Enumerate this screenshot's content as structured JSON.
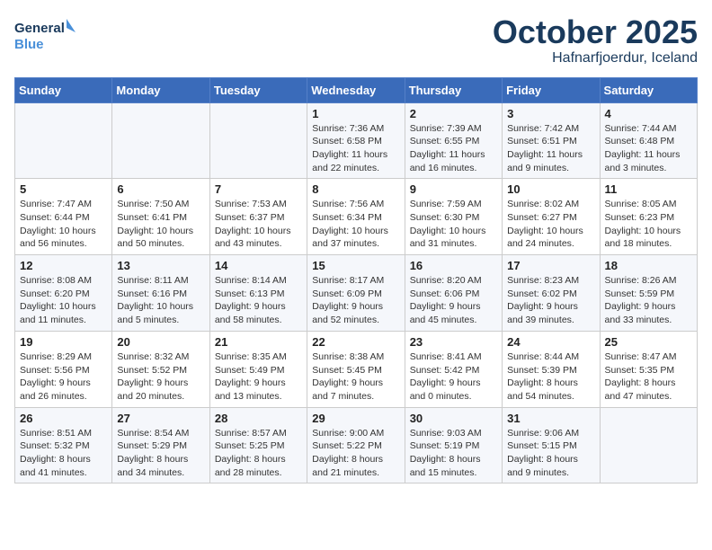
{
  "header": {
    "logo_line1": "General",
    "logo_line2": "Blue",
    "month": "October 2025",
    "location": "Hafnarfjoerdur, Iceland"
  },
  "weekdays": [
    "Sunday",
    "Monday",
    "Tuesday",
    "Wednesday",
    "Thursday",
    "Friday",
    "Saturday"
  ],
  "weeks": [
    [
      {
        "day": "",
        "info": ""
      },
      {
        "day": "",
        "info": ""
      },
      {
        "day": "",
        "info": ""
      },
      {
        "day": "1",
        "info": "Sunrise: 7:36 AM\nSunset: 6:58 PM\nDaylight: 11 hours\nand 22 minutes."
      },
      {
        "day": "2",
        "info": "Sunrise: 7:39 AM\nSunset: 6:55 PM\nDaylight: 11 hours\nand 16 minutes."
      },
      {
        "day": "3",
        "info": "Sunrise: 7:42 AM\nSunset: 6:51 PM\nDaylight: 11 hours\nand 9 minutes."
      },
      {
        "day": "4",
        "info": "Sunrise: 7:44 AM\nSunset: 6:48 PM\nDaylight: 11 hours\nand 3 minutes."
      }
    ],
    [
      {
        "day": "5",
        "info": "Sunrise: 7:47 AM\nSunset: 6:44 PM\nDaylight: 10 hours\nand 56 minutes."
      },
      {
        "day": "6",
        "info": "Sunrise: 7:50 AM\nSunset: 6:41 PM\nDaylight: 10 hours\nand 50 minutes."
      },
      {
        "day": "7",
        "info": "Sunrise: 7:53 AM\nSunset: 6:37 PM\nDaylight: 10 hours\nand 43 minutes."
      },
      {
        "day": "8",
        "info": "Sunrise: 7:56 AM\nSunset: 6:34 PM\nDaylight: 10 hours\nand 37 minutes."
      },
      {
        "day": "9",
        "info": "Sunrise: 7:59 AM\nSunset: 6:30 PM\nDaylight: 10 hours\nand 31 minutes."
      },
      {
        "day": "10",
        "info": "Sunrise: 8:02 AM\nSunset: 6:27 PM\nDaylight: 10 hours\nand 24 minutes."
      },
      {
        "day": "11",
        "info": "Sunrise: 8:05 AM\nSunset: 6:23 PM\nDaylight: 10 hours\nand 18 minutes."
      }
    ],
    [
      {
        "day": "12",
        "info": "Sunrise: 8:08 AM\nSunset: 6:20 PM\nDaylight: 10 hours\nand 11 minutes."
      },
      {
        "day": "13",
        "info": "Sunrise: 8:11 AM\nSunset: 6:16 PM\nDaylight: 10 hours\nand 5 minutes."
      },
      {
        "day": "14",
        "info": "Sunrise: 8:14 AM\nSunset: 6:13 PM\nDaylight: 9 hours\nand 58 minutes."
      },
      {
        "day": "15",
        "info": "Sunrise: 8:17 AM\nSunset: 6:09 PM\nDaylight: 9 hours\nand 52 minutes."
      },
      {
        "day": "16",
        "info": "Sunrise: 8:20 AM\nSunset: 6:06 PM\nDaylight: 9 hours\nand 45 minutes."
      },
      {
        "day": "17",
        "info": "Sunrise: 8:23 AM\nSunset: 6:02 PM\nDaylight: 9 hours\nand 39 minutes."
      },
      {
        "day": "18",
        "info": "Sunrise: 8:26 AM\nSunset: 5:59 PM\nDaylight: 9 hours\nand 33 minutes."
      }
    ],
    [
      {
        "day": "19",
        "info": "Sunrise: 8:29 AM\nSunset: 5:56 PM\nDaylight: 9 hours\nand 26 minutes."
      },
      {
        "day": "20",
        "info": "Sunrise: 8:32 AM\nSunset: 5:52 PM\nDaylight: 9 hours\nand 20 minutes."
      },
      {
        "day": "21",
        "info": "Sunrise: 8:35 AM\nSunset: 5:49 PM\nDaylight: 9 hours\nand 13 minutes."
      },
      {
        "day": "22",
        "info": "Sunrise: 8:38 AM\nSunset: 5:45 PM\nDaylight: 9 hours\nand 7 minutes."
      },
      {
        "day": "23",
        "info": "Sunrise: 8:41 AM\nSunset: 5:42 PM\nDaylight: 9 hours\nand 0 minutes."
      },
      {
        "day": "24",
        "info": "Sunrise: 8:44 AM\nSunset: 5:39 PM\nDaylight: 8 hours\nand 54 minutes."
      },
      {
        "day": "25",
        "info": "Sunrise: 8:47 AM\nSunset: 5:35 PM\nDaylight: 8 hours\nand 47 minutes."
      }
    ],
    [
      {
        "day": "26",
        "info": "Sunrise: 8:51 AM\nSunset: 5:32 PM\nDaylight: 8 hours\nand 41 minutes."
      },
      {
        "day": "27",
        "info": "Sunrise: 8:54 AM\nSunset: 5:29 PM\nDaylight: 8 hours\nand 34 minutes."
      },
      {
        "day": "28",
        "info": "Sunrise: 8:57 AM\nSunset: 5:25 PM\nDaylight: 8 hours\nand 28 minutes."
      },
      {
        "day": "29",
        "info": "Sunrise: 9:00 AM\nSunset: 5:22 PM\nDaylight: 8 hours\nand 21 minutes."
      },
      {
        "day": "30",
        "info": "Sunrise: 9:03 AM\nSunset: 5:19 PM\nDaylight: 8 hours\nand 15 minutes."
      },
      {
        "day": "31",
        "info": "Sunrise: 9:06 AM\nSunset: 5:15 PM\nDaylight: 8 hours\nand 9 minutes."
      },
      {
        "day": "",
        "info": ""
      }
    ]
  ]
}
